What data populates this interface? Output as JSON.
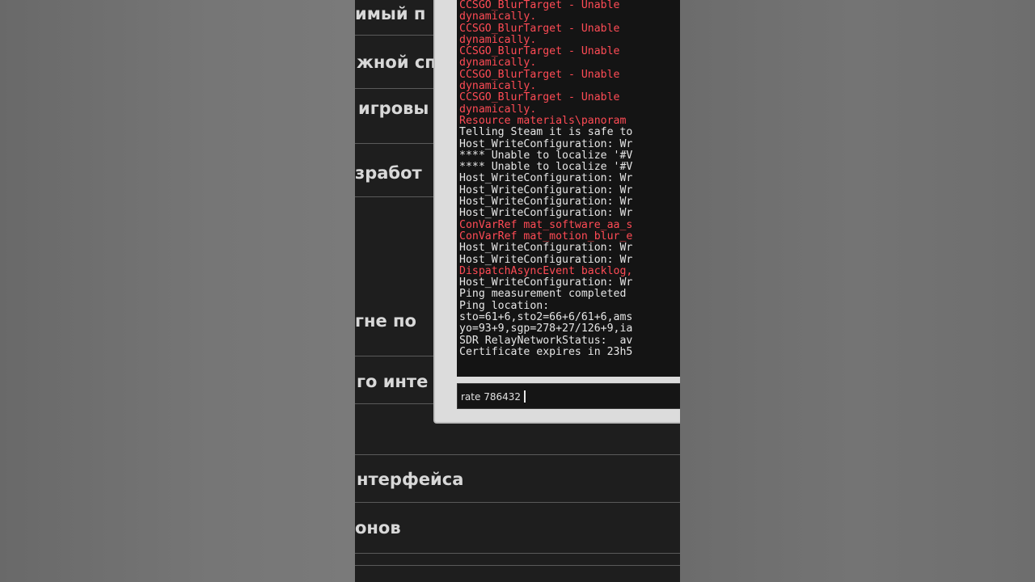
{
  "settings_menu": {
    "items": [
      {
        "label": "имый п"
      },
      {
        "label": "жной сп"
      },
      {
        "label": "игровы"
      },
      {
        "label": "зработ"
      },
      {
        "label": ""
      },
      {
        "label": "гне по"
      },
      {
        "label": "го инте"
      },
      {
        "label": ""
      },
      {
        "label": "нтерфейса"
      },
      {
        "label": "онов"
      }
    ]
  },
  "console": {
    "log_lines": [
      {
        "text": "CCSGO_BlurTarget - Unable",
        "type": "error"
      },
      {
        "text": "dynamically.",
        "type": "error"
      },
      {
        "text": "CCSGO_BlurTarget - Unable",
        "type": "error"
      },
      {
        "text": "dynamically.",
        "type": "error"
      },
      {
        "text": "CCSGO_BlurTarget - Unable",
        "type": "error"
      },
      {
        "text": "dynamically.",
        "type": "error"
      },
      {
        "text": "CCSGO_BlurTarget - Unable",
        "type": "error"
      },
      {
        "text": "dynamically.",
        "type": "error"
      },
      {
        "text": "CCSGO_BlurTarget - Unable",
        "type": "error"
      },
      {
        "text": "dynamically.",
        "type": "error"
      },
      {
        "text": "Resource materials\\panoram",
        "type": "error"
      },
      {
        "text": "Telling Steam it is safe to",
        "type": "normal"
      },
      {
        "text": "Host_WriteConfiguration: Wr",
        "type": "normal"
      },
      {
        "text": "**** Unable to localize '#V",
        "type": "normal"
      },
      {
        "text": "**** Unable to localize '#V",
        "type": "normal"
      },
      {
        "text": "Host_WriteConfiguration: Wr",
        "type": "normal"
      },
      {
        "text": "Host_WriteConfiguration: Wr",
        "type": "normal"
      },
      {
        "text": "Host_WriteConfiguration: Wr",
        "type": "normal"
      },
      {
        "text": "Host_WriteConfiguration: Wr",
        "type": "normal"
      },
      {
        "text": "ConVarRef mat_software_aa_s",
        "type": "error"
      },
      {
        "text": "ConVarRef mat_motion_blur_e",
        "type": "error"
      },
      {
        "text": "Host_WriteConfiguration: Wr",
        "type": "normal"
      },
      {
        "text": "Host_WriteConfiguration: Wr",
        "type": "normal"
      },
      {
        "text": "DispatchAsyncEvent backlog,",
        "type": "error"
      },
      {
        "text": "Host_WriteConfiguration: Wr",
        "type": "normal"
      },
      {
        "text": "Ping measurement completed",
        "type": "normal"
      },
      {
        "text": "Ping location:",
        "type": "normal"
      },
      {
        "text": "sto=61+6,sto2=66+6/61+6,ams",
        "type": "normal"
      },
      {
        "text": "yo=93+9,sgp=278+27/126+9,ia",
        "type": "normal"
      },
      {
        "text": "SDR RelayNetworkStatus:  av",
        "type": "normal"
      },
      {
        "text": "Certificate expires in 23h5",
        "type": "normal"
      }
    ],
    "input_value": "rate 786432"
  },
  "colors": {
    "error_text": "#ff4b55",
    "normal_text": "#e6e6e6",
    "console_frame": "#dcdcdc",
    "console_bg": "#141414"
  }
}
